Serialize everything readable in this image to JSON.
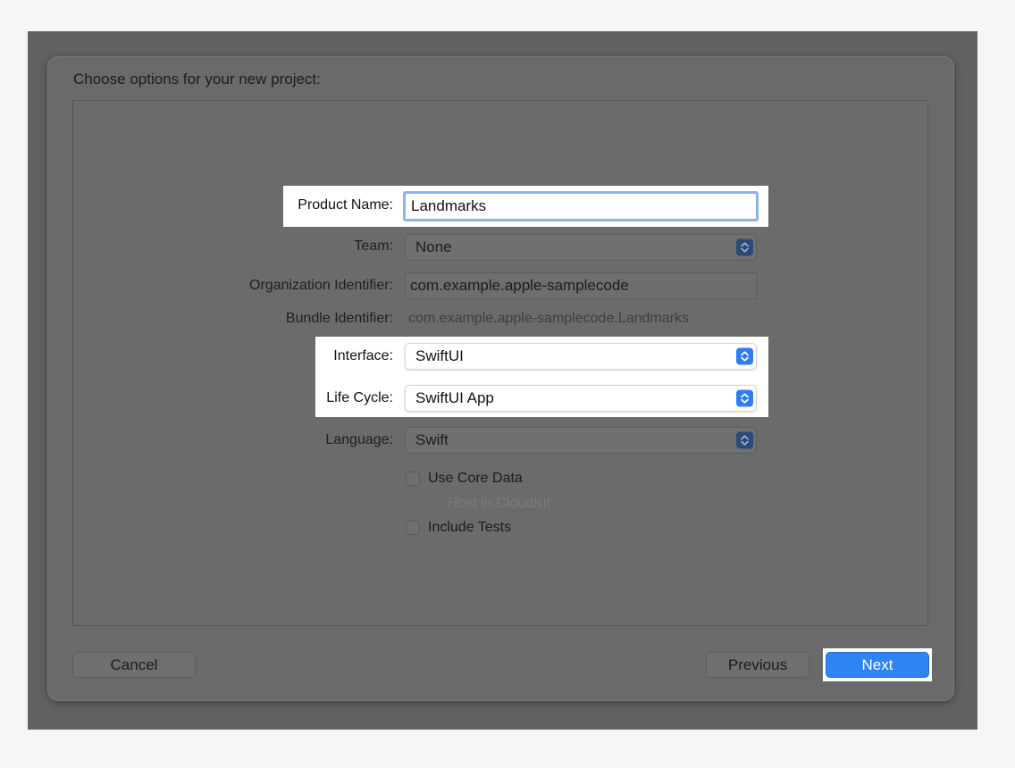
{
  "dialog": {
    "title": "Choose options for your new project:"
  },
  "form": {
    "product_name": {
      "label": "Product Name:",
      "value": "Landmarks"
    },
    "team": {
      "label": "Team:",
      "value": "None"
    },
    "organization_identifier": {
      "label": "Organization Identifier:",
      "value": "com.example.apple-samplecode"
    },
    "bundle_identifier": {
      "label": "Bundle Identifier:",
      "value": "com.example.apple-samplecode.Landmarks"
    },
    "interface": {
      "label": "Interface:",
      "value": "SwiftUI"
    },
    "life_cycle": {
      "label": "Life Cycle:",
      "value": "SwiftUI App"
    },
    "language": {
      "label": "Language:",
      "value": "Swift"
    },
    "options": {
      "use_core_data": {
        "label": "Use Core Data",
        "checked": false
      },
      "host_in_cloudkit": {
        "label": "Host in CloudKit",
        "checked": false,
        "enabled": false
      },
      "include_tests": {
        "label": "Include Tests",
        "checked": false
      }
    }
  },
  "buttons": {
    "cancel": "Cancel",
    "previous": "Previous",
    "next": "Next"
  },
  "icons": {
    "popup_stepper": "chevron-up-down-icon"
  },
  "colors": {
    "accent": "#2f84f4",
    "highlight": "#ffffff",
    "dimmed_overlay": "#626262"
  }
}
